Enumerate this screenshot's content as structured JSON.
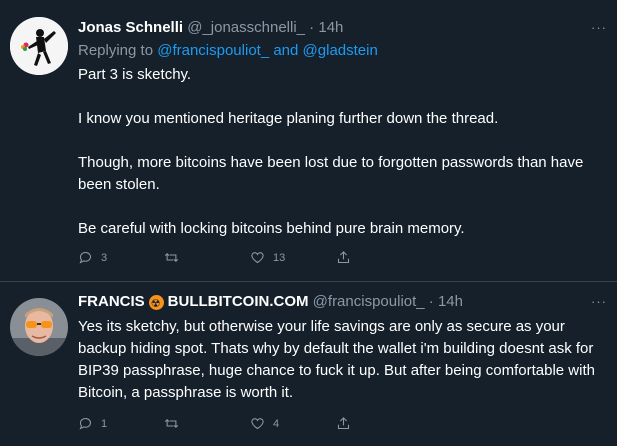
{
  "tweet1": {
    "name": "Jonas Schnelli",
    "handle": "@_jonasschnelli_",
    "time": "14h",
    "more": "···",
    "reply_prefix": "Replying to",
    "reply_user1": "@francispouliot_",
    "reply_and": "and",
    "reply_user2": "@gladstein",
    "paragraphs": [
      "Part 3 is sketchy.",
      "I know you mentioned heritage planing further down the thread.",
      "Though, more bitcoins have been lost due to forgotten passwords than have been stolen.",
      "Be careful with locking bitcoins behind pure brain memory."
    ],
    "reply_count": "3",
    "retweet_count": "",
    "like_count": "13"
  },
  "tweet2": {
    "name_part1": "FRANCIS",
    "name_part2": "BULLBITCOIN.COM",
    "handle": "@francispouliot_",
    "time": "14h",
    "more": "···",
    "text": "Yes its sketchy, but otherwise your life savings are only as secure as your backup hiding spot. Thats why by default the wallet i'm building doesnt ask for BIP39 passphrase, huge chance to fuck it up. But after being comfortable with Bitcoin, a passphrase is worth it.",
    "reply_count": "1",
    "retweet_count": "",
    "like_count": "4"
  },
  "colors": {
    "background": "#15202b",
    "link": "#1d9bf0",
    "muted": "#8b98a5",
    "divider": "#38444d"
  },
  "icons": [
    "reply-icon",
    "retweet-icon",
    "like-icon",
    "share-icon",
    "more-icon",
    "radioactive-badge-icon"
  ]
}
